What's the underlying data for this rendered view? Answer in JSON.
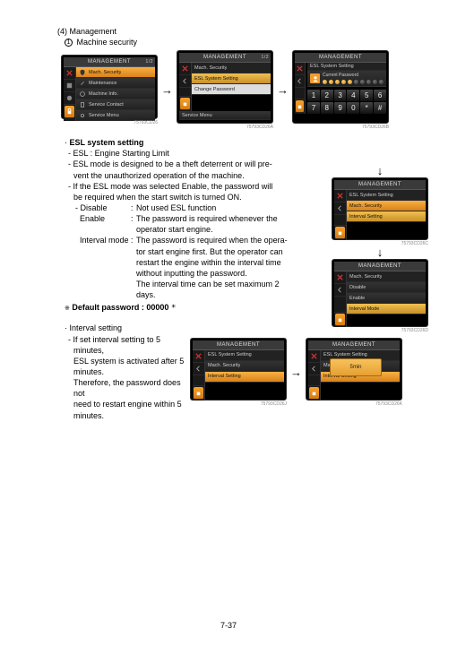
{
  "headings": {
    "section_no": "(4)",
    "section_title": "Management",
    "sub1_num": "1",
    "sub1_title": "Machine security"
  },
  "screens": {
    "a": {
      "title": "MANAGEMENT",
      "page": "1/2",
      "items": [
        "Mach. Security",
        "Maintenance",
        "Machine Info.",
        "Service Contact",
        "Service Menu"
      ],
      "code": "75793CD26"
    },
    "b": {
      "title": "MANAGEMENT",
      "page": "1/2",
      "breadcrumb": "Mach. Security",
      "items": [
        "ESL System Setting",
        "Change Password"
      ],
      "footer": "Service Menu",
      "code": "75793CD26A"
    },
    "c": {
      "title": "MANAGEMENT",
      "breadcrumb": "ESL System Setting",
      "cp_label": "Current Password",
      "keys": [
        "1",
        "2",
        "3",
        "4",
        "5",
        "6",
        "7",
        "8",
        "9",
        "0",
        "*",
        "#"
      ],
      "code": "75793CD26B"
    },
    "d": {
      "title": "MANAGEMENT",
      "breadcrumb": "ESL System Setting",
      "items": [
        "Mach. Security",
        "Interval Setting"
      ],
      "code": "75793CD26C"
    },
    "e": {
      "title": "MANAGEMENT",
      "breadcrumb": "Mach. Security",
      "items": [
        "Disable",
        "Enable",
        "Interval Mode"
      ],
      "code": "75793CD26D"
    },
    "f": {
      "title": "MANAGEMENT",
      "breadcrumb": "ESL System Setting",
      "items": [
        "Mach. Security",
        "Interval Setting"
      ],
      "code": "75793CD26J"
    },
    "g": {
      "title": "MANAGEMENT",
      "breadcrumb": "ESL System Setting",
      "items": [
        "Mach. Security",
        "Interval Setting"
      ],
      "popup": "5min",
      "code": "75793CD26K"
    }
  },
  "text": {
    "esl_heading": "ESL system setting",
    "esl_def": "ESL : Engine Starting Limit",
    "esl_mode1": "ESL mode is designed to be a theft deterrent or will pre-",
    "esl_mode2": "vent the unauthorized operation of the machine.",
    "esl_pw1": "If the ESL mode was selected Enable, the password will",
    "esl_pw2": "be required when the start switch is turned ON.",
    "disable_term": "Disable",
    "disable_desc": "Not used ESL function",
    "enable_term": "Enable",
    "enable_desc1": "The password is required whenever the",
    "enable_desc2": "operator start engine.",
    "interval_term": "Interval mode",
    "interval_desc1": "The password is required when the opera-",
    "interval_desc2": "tor start engine first. But the operator can",
    "interval_desc3": "restart the engine within the interval time",
    "interval_desc4": "without inputting the password.",
    "interval_desc5": "The interval time can be set maximum 2",
    "interval_desc6": "days.",
    "default_pw": "Default password : 00000",
    "star": "*",
    "intset_heading": "Interval setting",
    "int1": "If set interval setting to 5 minutes,",
    "int2": "ESL system is activated after 5",
    "int3": "minutes.",
    "int4": "Therefore, the password does not",
    "int5": "need to restart engine within 5",
    "int6": "minutes."
  },
  "page_number": "7-37"
}
